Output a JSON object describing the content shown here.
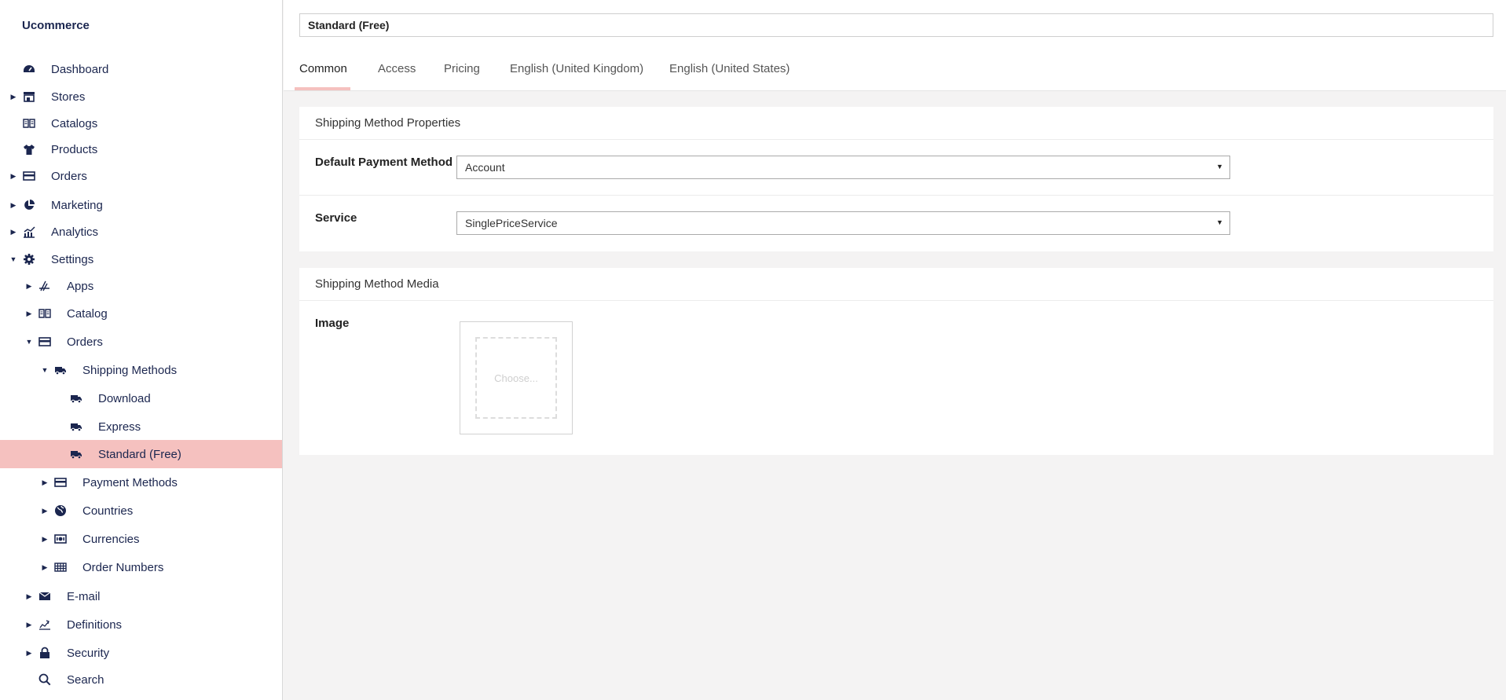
{
  "app": {
    "brand": "Ucommerce"
  },
  "sidebar": {
    "items": [
      {
        "label": "Dashboard",
        "icon": "dashboard-icon"
      },
      {
        "label": "Stores",
        "icon": "store-icon"
      },
      {
        "label": "Catalogs",
        "icon": "catalog-book-icon"
      },
      {
        "label": "Products",
        "icon": "tshirt-icon"
      },
      {
        "label": "Orders",
        "icon": "orders-icon"
      },
      {
        "label": "Marketing",
        "icon": "pie-chart-icon"
      },
      {
        "label": "Analytics",
        "icon": "analytics-icon"
      },
      {
        "label": "Settings",
        "icon": "gear-icon"
      },
      {
        "label": "Apps",
        "icon": "apps-icon"
      },
      {
        "label": "Catalog",
        "icon": "catalog-book-icon"
      },
      {
        "label": "Orders",
        "icon": "orders-icon"
      },
      {
        "label": "Shipping Methods",
        "icon": "truck-icon"
      },
      {
        "label": "Download",
        "icon": "truck-icon"
      },
      {
        "label": "Express",
        "icon": "truck-icon"
      },
      {
        "label": "Standard (Free)",
        "icon": "truck-icon"
      },
      {
        "label": "Payment Methods",
        "icon": "credit-card-icon"
      },
      {
        "label": "Countries",
        "icon": "globe-icon"
      },
      {
        "label": "Currencies",
        "icon": "money-icon"
      },
      {
        "label": "Order Numbers",
        "icon": "grid-icon"
      },
      {
        "label": "E-mail",
        "icon": "envelope-icon"
      },
      {
        "label": "Definitions",
        "icon": "definitions-icon"
      },
      {
        "label": "Security",
        "icon": "lock-icon"
      },
      {
        "label": "Search",
        "icon": "search-icon"
      }
    ]
  },
  "editor": {
    "name_value": "Standard (Free)",
    "tabs": [
      "Common",
      "Access",
      "Pricing",
      "English (United Kingdom)",
      "English (United States)"
    ],
    "active_tab": "Common",
    "properties": {
      "title": "Shipping Method Properties",
      "default_payment_label": "Default Payment Method",
      "default_payment_value": "Account",
      "service_label": "Service",
      "service_value": "SinglePriceService"
    },
    "media": {
      "title": "Shipping Method Media",
      "image_label": "Image",
      "choose_placeholder": "Choose..."
    }
  },
  "colors": {
    "text_primary": "#1b264f",
    "active_highlight": "#f5c1bf",
    "background": "#f4f3f3"
  }
}
